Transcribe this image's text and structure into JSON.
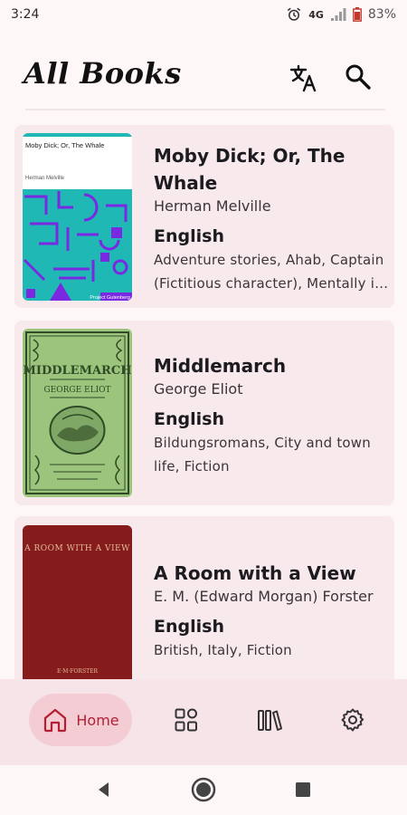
{
  "status_bar": {
    "time": "3:24",
    "network": "4G",
    "battery": "83%",
    "icons": [
      "alarm-icon",
      "signal-icon",
      "battery-icon"
    ]
  },
  "app_bar": {
    "title": "All Books",
    "actions": [
      "translate-icon",
      "search-icon"
    ]
  },
  "books": [
    {
      "title": "Moby Dick; Or, The Whale",
      "author": "Herman Melville",
      "language": "English",
      "subjects": "Adventure stories, Ahab, Captain (Fictitious character), Mentally ill -- Fiction, Psychological fiction",
      "cover": {
        "title": "Moby Dick; Or, The Whale",
        "author": "Herman Melville",
        "publisher": "Project Gutenberg",
        "colors": {
          "band": "#1fb8b4",
          "shapes": "#7a28e2"
        }
      }
    },
    {
      "title": "Middlemarch",
      "author": "George Eliot",
      "language": "English",
      "subjects": "Bildungsromans, City and town life, Fiction",
      "cover": {
        "title": "MIDDLEMARCH",
        "author": "GEORGE ELIOT",
        "colors": {
          "paper": "#9dc47c",
          "ink": "#2e4a26"
        }
      }
    },
    {
      "title": "A Room with a View",
      "author": "E. M. (Edward Morgan) Forster",
      "language": "English",
      "subjects": "British, Italy, Fiction",
      "cover": {
        "title": "A ROOM WITH A VIEW",
        "author": "E·M·FORSTER",
        "colors": {
          "cloth": "#8a1d1d",
          "text": "#e0b8a0"
        }
      }
    }
  ],
  "bottom_nav": {
    "items": [
      {
        "label": "Home",
        "icon": "home-icon",
        "selected": true
      },
      {
        "label": "",
        "icon": "grid-icon",
        "selected": false
      },
      {
        "label": "",
        "icon": "library-icon",
        "selected": false
      },
      {
        "label": "",
        "icon": "settings-gear-icon",
        "selected": false
      }
    ]
  },
  "theme": {
    "background": "#fdf7f8",
    "card": "#f8e9ed",
    "accent": "#b51f33",
    "nav_background": "#f6e4e9",
    "nav_selected": "#f3cdd3"
  }
}
